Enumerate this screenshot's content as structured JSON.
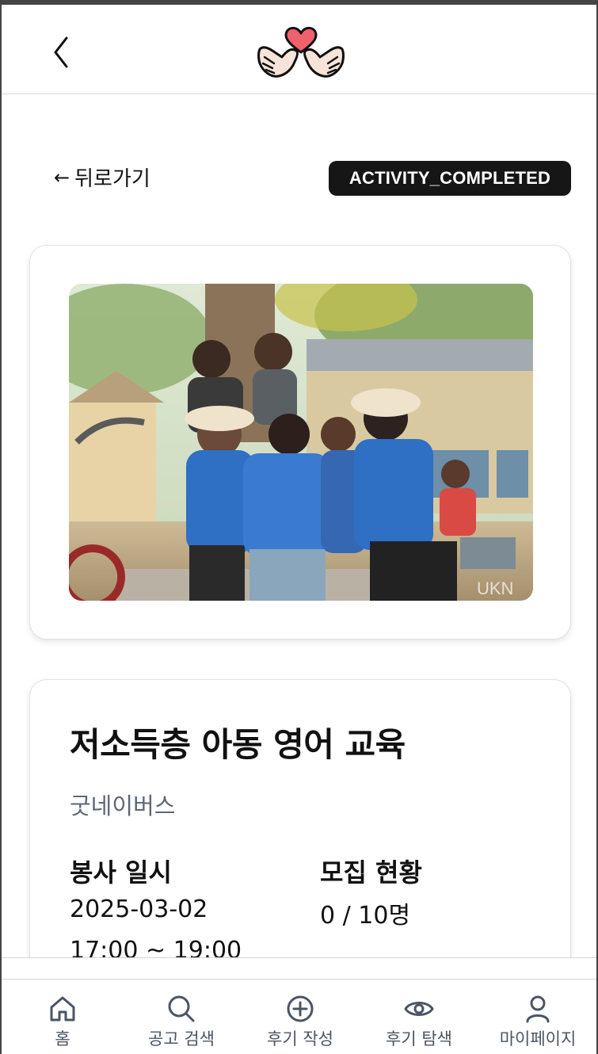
{
  "header": {
    "back_icon": "chevron-left-icon",
    "logo": "hands-heart-logo"
  },
  "page": {
    "back_label": "뒤로가기",
    "back_arrow": "←",
    "status": "ACTIVITY_COMPLETED"
  },
  "activity": {
    "image_alt": "volunteer-group-photo",
    "title": "저소득층 아동 영어 교육",
    "organization": "굿네이버스",
    "schedule_label": "봉사 일시",
    "date": "2025-03-02",
    "time": "17:00 ~ 19:00",
    "recruit_label": "모집 현황",
    "recruit_value": "0 / 10명"
  },
  "tabs": [
    {
      "label": "홈",
      "icon": "home-icon"
    },
    {
      "label": "공고 검색",
      "icon": "search-icon"
    },
    {
      "label": "후기 작성",
      "icon": "plus-circle-icon"
    },
    {
      "label": "후기 탐색",
      "icon": "eye-icon"
    },
    {
      "label": "마이페이지",
      "icon": "user-icon"
    }
  ],
  "colors": {
    "badge_bg": "#161616",
    "logo_heart": "#f0616c",
    "subtle_text": "#5e6675",
    "tab_text": "#4b5563"
  }
}
